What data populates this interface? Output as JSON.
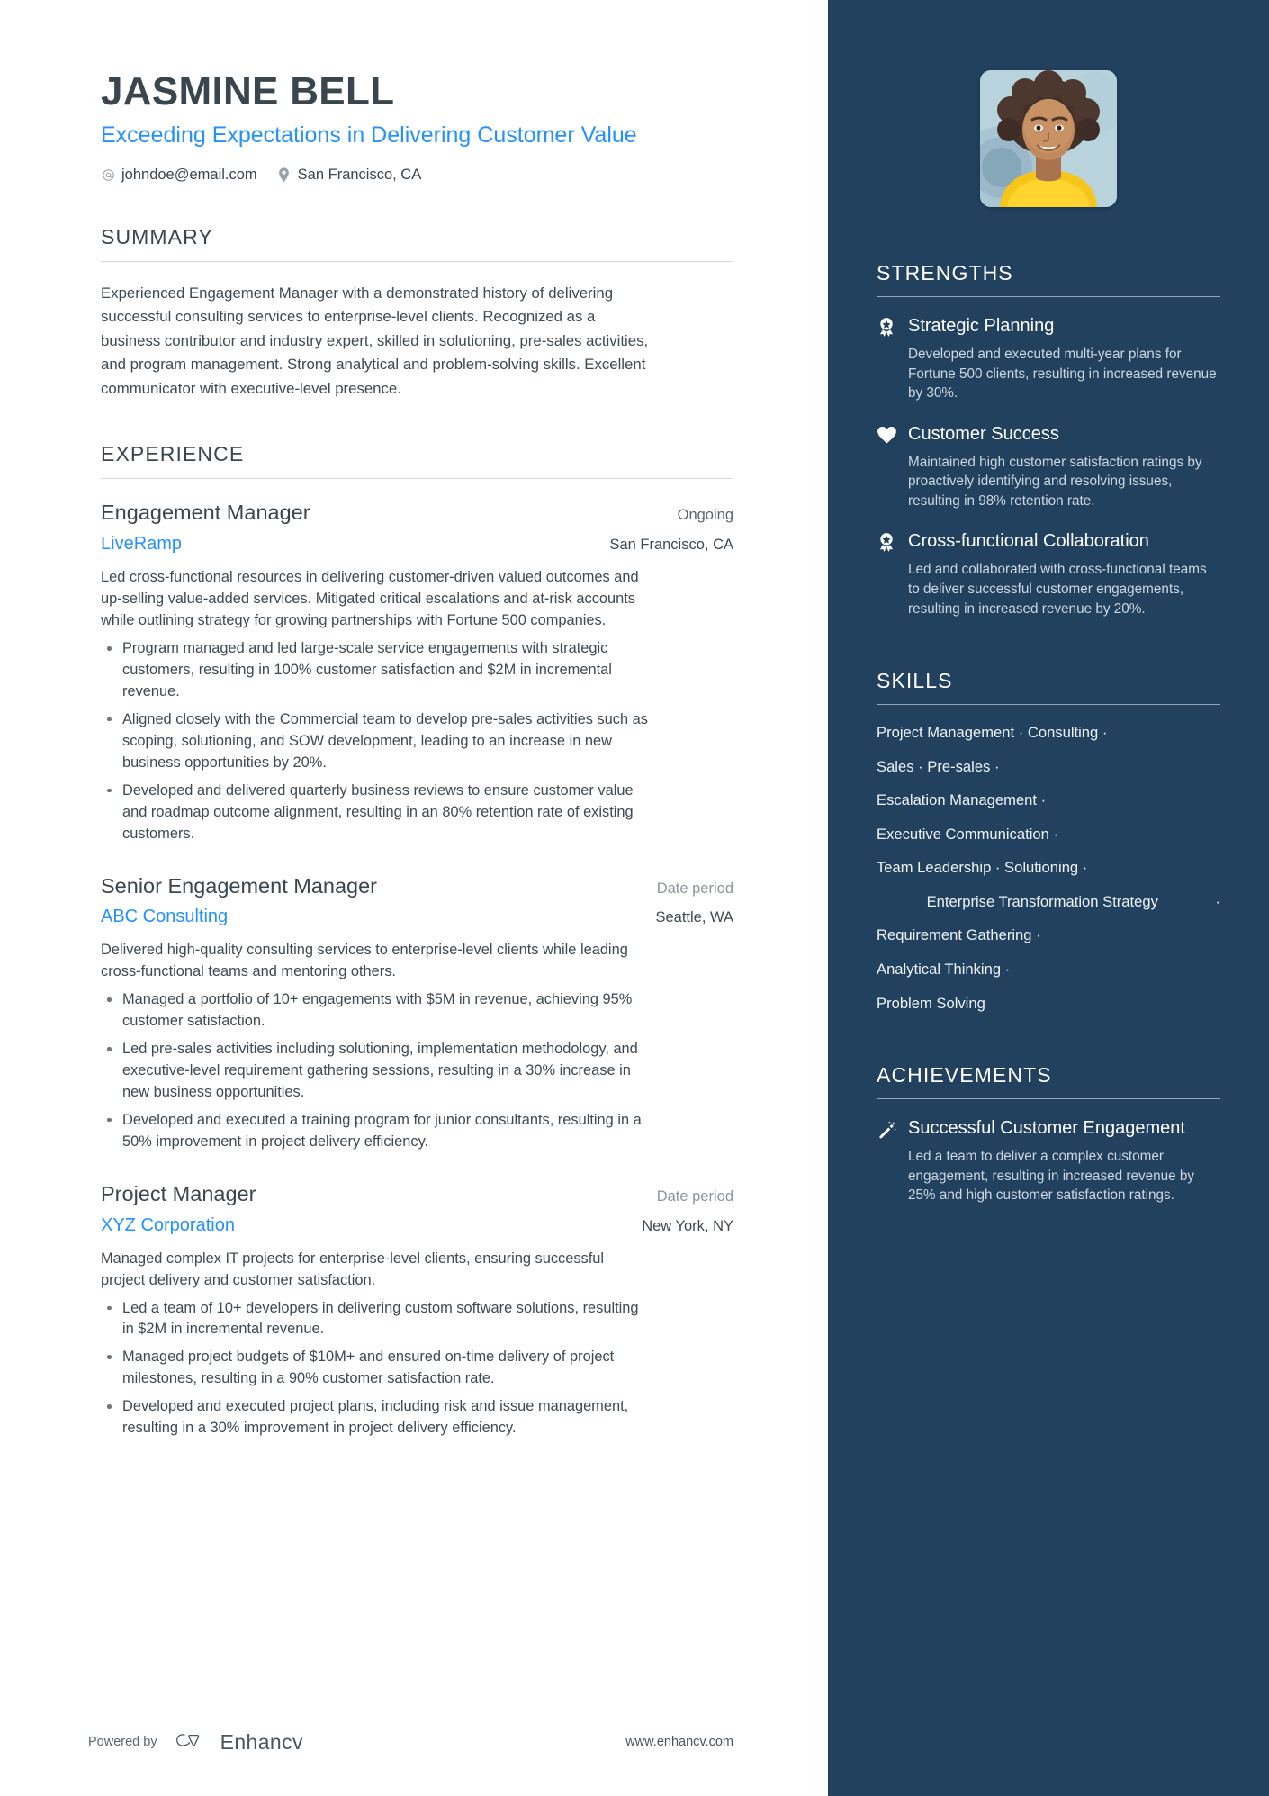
{
  "header": {
    "name": "JASMINE BELL",
    "tagline": "Exceeding Expectations in Delivering Customer Value",
    "email": "johndoe@email.com",
    "location": "San Francisco, CA"
  },
  "summary": {
    "title": "SUMMARY",
    "text": "Experienced Engagement Manager with a demonstrated history of delivering successful consulting services to enterprise-level clients. Recognized as a business contributor and industry expert, skilled in solutioning, pre-sales activities, and program management. Strong analytical and problem-solving skills. Excellent communicator with executive-level presence."
  },
  "experience": {
    "title": "EXPERIENCE",
    "jobs": [
      {
        "title": "Engagement Manager",
        "date": "Ongoing",
        "date_muted": false,
        "company": "LiveRamp",
        "location": "San Francisco, CA",
        "description": "Led cross-functional resources in delivering customer-driven valued outcomes and up-selling value-added services. Mitigated critical escalations and at-risk accounts while outlining strategy for growing partnerships with Fortune 500 companies.",
        "bullets": [
          "Program managed and led large-scale service engagements with strategic customers, resulting in 100% customer satisfaction and $2M in incremental revenue.",
          "Aligned closely with the Commercial team to develop pre-sales activities such as scoping, solutioning, and SOW development, leading to an increase in new business opportunities by 20%.",
          "Developed and delivered quarterly business reviews to ensure customer value and roadmap outcome alignment, resulting in an 80% retention rate of existing customers."
        ]
      },
      {
        "title": "Senior Engagement Manager",
        "date": "Date period",
        "date_muted": true,
        "company": "ABC Consulting",
        "location": "Seattle, WA",
        "description": "Delivered high-quality consulting services to enterprise-level clients while leading cross-functional teams and mentoring others.",
        "bullets": [
          "Managed a portfolio of 10+ engagements with $5M in revenue, achieving 95% customer satisfaction.",
          "Led pre-sales activities including solutioning, implementation methodology, and executive-level requirement gathering sessions, resulting in a 30% increase in new business opportunities.",
          "Developed and executed a training program for junior consultants, resulting in a 50% improvement in project delivery efficiency."
        ]
      },
      {
        "title": "Project Manager",
        "date": "Date period",
        "date_muted": true,
        "company": "XYZ Corporation",
        "location": "New York, NY",
        "description": "Managed complex IT projects for enterprise-level clients, ensuring successful project delivery and customer satisfaction.",
        "bullets": [
          "Led a team of 10+ developers in delivering custom software solutions, resulting in $2M in incremental revenue.",
          "Managed project budgets of $10M+ and ensured on-time delivery of project milestones, resulting in a 90% customer satisfaction rate.",
          "Developed and executed project plans, including risk and issue management, resulting in a 30% improvement in project delivery efficiency."
        ]
      }
    ]
  },
  "strengths": {
    "title": "STRENGTHS",
    "items": [
      {
        "icon": "award-ribbon-icon",
        "name": "Strategic Planning",
        "description": "Developed and executed multi-year plans for Fortune 500 clients, resulting in increased revenue by 30%."
      },
      {
        "icon": "heart-icon",
        "name": "Customer Success",
        "description": "Maintained high customer satisfaction ratings by proactively identifying and resolving issues, resulting in 98% retention rate."
      },
      {
        "icon": "award-ribbon-icon",
        "name": "Cross-functional Collaboration",
        "description": "Led and collaborated with cross-functional teams to deliver successful customer engagements, resulting in increased revenue by 20%."
      }
    ]
  },
  "skills": {
    "title": "SKILLS",
    "lines": [
      {
        "text": "Project Management · Consulting ·",
        "align": "left"
      },
      {
        "text": "Sales · Pre-sales ·",
        "align": "left"
      },
      {
        "text": "Escalation Management ·",
        "align": "left"
      },
      {
        "text": "Executive Communication ·",
        "align": "left"
      },
      {
        "text": "Team Leadership · Solutioning ·",
        "align": "left"
      },
      {
        "text": "Enterprise Transformation Strategy",
        "align": "center",
        "trailing_dot": "·"
      },
      {
        "text": "Requirement Gathering ·",
        "align": "left"
      },
      {
        "text": "Analytical Thinking ·",
        "align": "left"
      },
      {
        "text": "Problem Solving",
        "align": "left"
      }
    ],
    "items": [
      "Project Management",
      "Consulting",
      "Sales",
      "Pre-sales",
      "Escalation Management",
      "Executive Communication",
      "Team Leadership",
      "Solutioning",
      "Enterprise Transformation Strategy",
      "Requirement Gathering",
      "Analytical Thinking",
      "Problem Solving"
    ]
  },
  "achievements": {
    "title": "ACHIEVEMENTS",
    "items": [
      {
        "icon": "magic-wand-icon",
        "name": "Successful Customer Engagement",
        "description": "Led a team to deliver a complex customer engagement, resulting in increased revenue by 25% and high customer satisfaction ratings."
      }
    ]
  },
  "footer": {
    "powered_by": "Powered by",
    "brand": "Enhancv",
    "website": "www.enhancv.com"
  },
  "colors": {
    "accent_blue": "#2491ff",
    "sidebar_navy": "#22415f",
    "text_dark": "#3a464e",
    "muted": "#8d959b"
  }
}
